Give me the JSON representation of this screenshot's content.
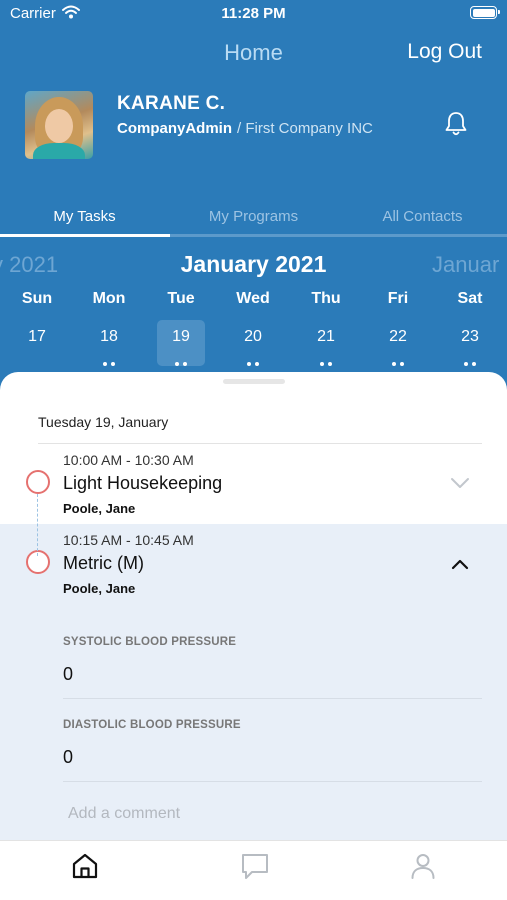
{
  "status_bar": {
    "carrier": "Carrier",
    "time": "11:28 PM"
  },
  "nav": {
    "title": "Home",
    "logout": "Log Out"
  },
  "user": {
    "name": "KARANE C.",
    "role": "CompanyAdmin",
    "company": "/ First Company INC"
  },
  "tabs": [
    {
      "label": "My Tasks",
      "active": true
    },
    {
      "label": "My Programs",
      "active": false
    },
    {
      "label": "All Contacts",
      "active": false
    }
  ],
  "calendar": {
    "prev_month": "y 2021",
    "current_month": "January 2021",
    "next_month": "Januar",
    "days": [
      {
        "name": "Sun",
        "num": "17",
        "dots": 0,
        "selected": false
      },
      {
        "name": "Mon",
        "num": "18",
        "dots": 2,
        "selected": false
      },
      {
        "name": "Tue",
        "num": "19",
        "dots": 2,
        "selected": true
      },
      {
        "name": "Wed",
        "num": "20",
        "dots": 2,
        "selected": false
      },
      {
        "name": "Thu",
        "num": "21",
        "dots": 2,
        "selected": false
      },
      {
        "name": "Fri",
        "num": "22",
        "dots": 2,
        "selected": false
      },
      {
        "name": "Sat",
        "num": "23",
        "dots": 2,
        "selected": false
      }
    ]
  },
  "schedule": {
    "date_heading": "Tuesday 19, January",
    "tasks": [
      {
        "time": "10:00 AM - 10:30 AM",
        "title": "Light Housekeeping",
        "person": "Poole, Jane",
        "expanded": false
      },
      {
        "time": "10:15 AM - 10:45 AM",
        "title": "Metric (M)",
        "person": "Poole, Jane",
        "expanded": true,
        "metrics": [
          {
            "label": "SYSTOLIC BLOOD PRESSURE",
            "value": "0"
          },
          {
            "label": "DIASTOLIC BLOOD PRESSURE",
            "value": "0"
          }
        ],
        "comment_placeholder": "Add a comment"
      }
    ]
  },
  "tabbar": [
    {
      "icon": "home-icon",
      "active": true
    },
    {
      "icon": "chat-icon",
      "active": false
    },
    {
      "icon": "profile-icon",
      "active": false
    }
  ],
  "colors": {
    "header_bg": "#2b7bb9",
    "selected_day_bg": "#4c90c5",
    "task_circle": "#e5716f",
    "expanded_task_bg": "#e8eff8"
  }
}
